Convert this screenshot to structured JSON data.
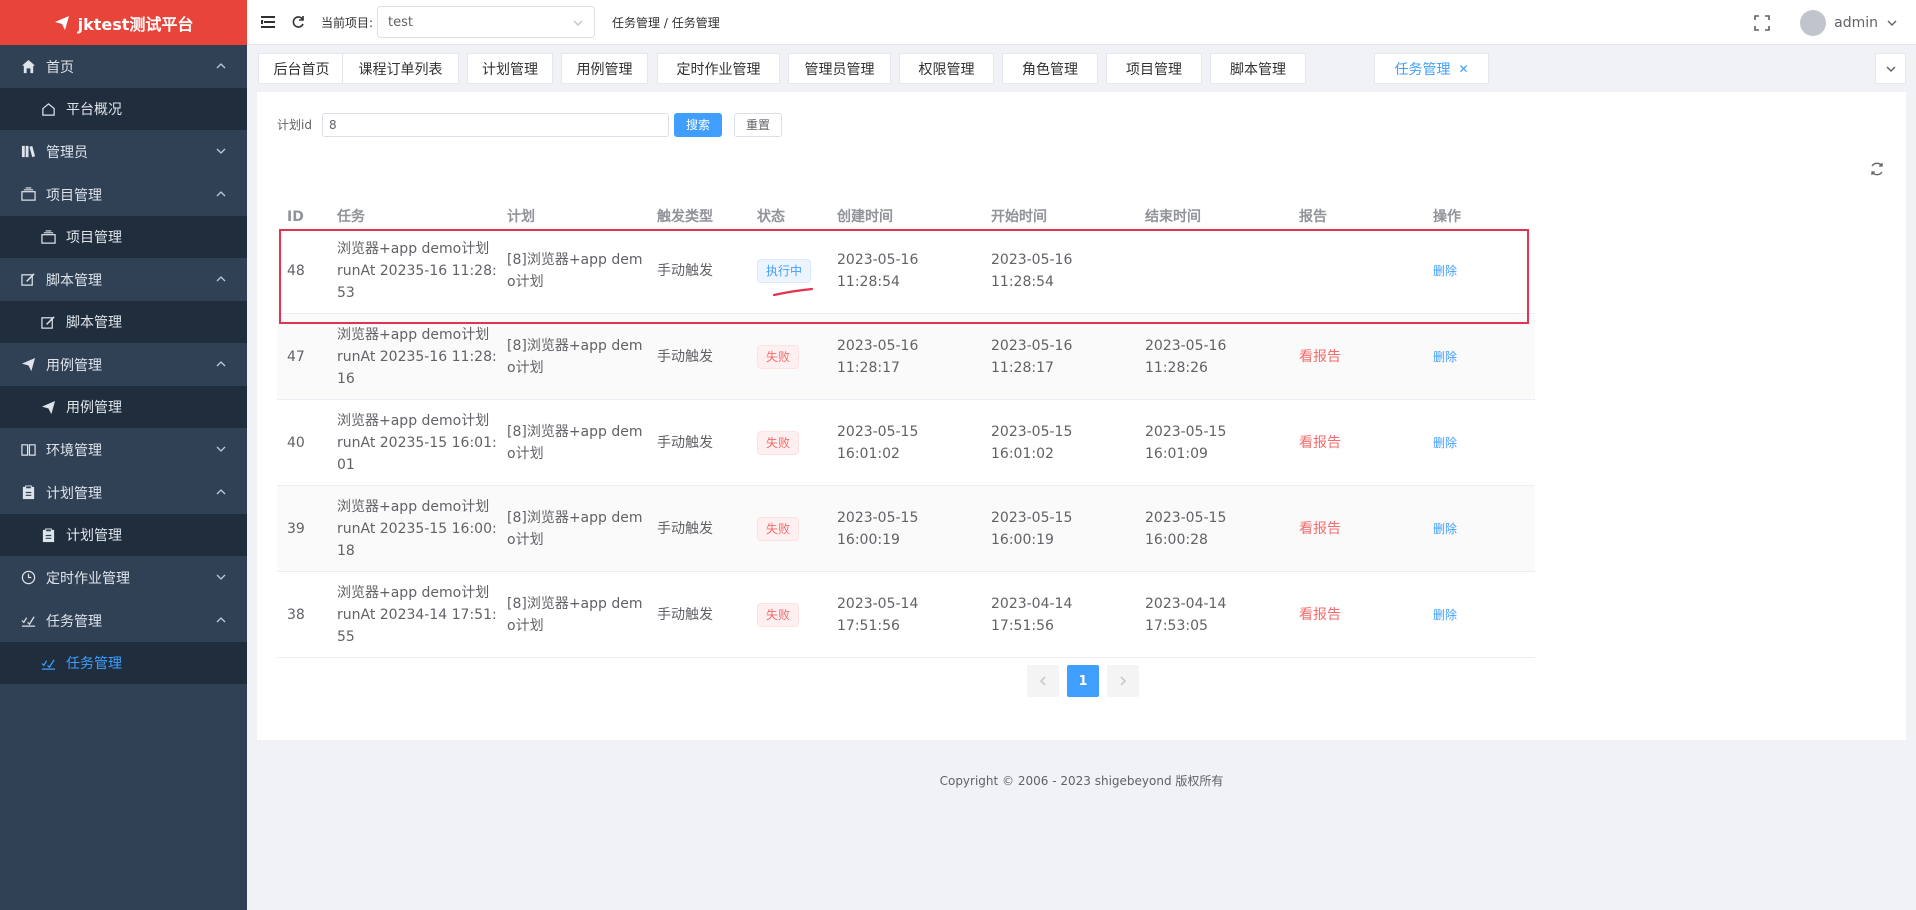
{
  "app": {
    "title": "jktest测试平台"
  },
  "sidebar": {
    "items": [
      {
        "label": "首页",
        "icon": "home-icon",
        "expanded": true,
        "children": [
          {
            "label": "平台概况",
            "icon": "house-outline-icon"
          }
        ]
      },
      {
        "label": "管理员",
        "icon": "books-icon",
        "expanded": false,
        "children": []
      },
      {
        "label": "项目管理",
        "icon": "stack-icon",
        "expanded": true,
        "children": [
          {
            "label": "项目管理",
            "icon": "stack-icon"
          }
        ]
      },
      {
        "label": "脚本管理",
        "icon": "edit-icon",
        "expanded": true,
        "children": [
          {
            "label": "脚本管理",
            "icon": "edit-icon"
          }
        ]
      },
      {
        "label": "用例管理",
        "icon": "send-icon",
        "expanded": true,
        "children": [
          {
            "label": "用例管理",
            "icon": "send-icon"
          }
        ]
      },
      {
        "label": "环境管理",
        "icon": "book-open-icon",
        "expanded": false,
        "children": []
      },
      {
        "label": "计划管理",
        "icon": "clipboard-icon",
        "expanded": true,
        "children": [
          {
            "label": "计划管理",
            "icon": "clipboard-icon"
          }
        ]
      },
      {
        "label": "定时作业管理",
        "icon": "clock-icon",
        "expanded": false,
        "children": []
      },
      {
        "label": "任务管理",
        "icon": "checklist-icon",
        "expanded": true,
        "children": [
          {
            "label": "任务管理",
            "icon": "checklist-icon",
            "active": true
          }
        ]
      }
    ]
  },
  "topbar": {
    "project_label": "当前项目:",
    "project_value": "test",
    "breadcrumb": "任务管理 / 任务管理",
    "user": "admin"
  },
  "tabs": [
    "后台首页",
    "课程订单列表",
    "计划管理",
    "用例管理",
    "定时作业管理",
    "管理员管理",
    "权限管理",
    "角色管理",
    "项目管理",
    "脚本管理",
    "任务管理"
  ],
  "active_tab": "任务管理",
  "search": {
    "label": "计划id",
    "value": "8",
    "search_btn": "搜索",
    "reset_btn": "重置"
  },
  "table": {
    "headers": [
      "ID",
      "任务",
      "计划",
      "触发类型",
      "状态",
      "创建时间",
      "开始时间",
      "结束时间",
      "报告",
      "操作"
    ],
    "rows": [
      {
        "id": "48",
        "task": [
          "浏览器+app demo计划",
          "runAt 20235-16 11:28:",
          "53"
        ],
        "plan": [
          "[8]浏览器+app dem",
          "o计划"
        ],
        "trigger": "手动触发",
        "status": "执行中",
        "status_type": "running",
        "created": "2023-05-16 11:28:54",
        "start": "2023-05-16 11:28:54",
        "end": "",
        "report": "",
        "action": "删除"
      },
      {
        "id": "47",
        "task": [
          "浏览器+app demo计划",
          "runAt 20235-16 11:28:",
          "16"
        ],
        "plan": [
          "[8]浏览器+app dem",
          "o计划"
        ],
        "trigger": "手动触发",
        "status": "失败",
        "status_type": "fail",
        "created": "2023-05-16 11:28:17",
        "start": "2023-05-16 11:28:17",
        "end": "2023-05-16 11:28:26",
        "report": "看报告",
        "action": "删除"
      },
      {
        "id": "40",
        "task": [
          "浏览器+app demo计划",
          "runAt 20235-15 16:01:",
          "01"
        ],
        "plan": [
          "[8]浏览器+app dem",
          "o计划"
        ],
        "trigger": "手动触发",
        "status": "失败",
        "status_type": "fail",
        "created": "2023-05-15 16:01:02",
        "start": "2023-05-15 16:01:02",
        "end": "2023-05-15 16:01:09",
        "report": "看报告",
        "action": "删除"
      },
      {
        "id": "39",
        "task": [
          "浏览器+app demo计划",
          "runAt 20235-15 16:00:",
          "18"
        ],
        "plan": [
          "[8]浏览器+app dem",
          "o计划"
        ],
        "trigger": "手动触发",
        "status": "失败",
        "status_type": "fail",
        "created": "2023-05-15 16:00:19",
        "start": "2023-05-15 16:00:19",
        "end": "2023-05-15 16:00:28",
        "report": "看报告",
        "action": "删除"
      },
      {
        "id": "38",
        "task": [
          "浏览器+app demo计划",
          "runAt 20234-14 17:51:",
          "55"
        ],
        "plan": [
          "[8]浏览器+app dem",
          "o计划"
        ],
        "trigger": "手动触发",
        "status": "失败",
        "status_type": "fail",
        "created": "2023-05-14 17:51:56",
        "start": "2023-04-14 17:51:56",
        "end": "2023-04-14 17:53:05",
        "report": "看报告",
        "action": "删除"
      }
    ]
  },
  "pagination": {
    "current": "1",
    "prev_icon": "chevron-left-icon",
    "next_icon": "chevron-right-icon"
  },
  "footer": "Copyright © 2006 - 2023 shigebeyond 版权所有",
  "colors": {
    "sidebar_bg": "#304156",
    "logo_bg": "#e8443a",
    "primary": "#409eff",
    "danger": "#f56c6c",
    "highlight_box": "#e4334f"
  }
}
